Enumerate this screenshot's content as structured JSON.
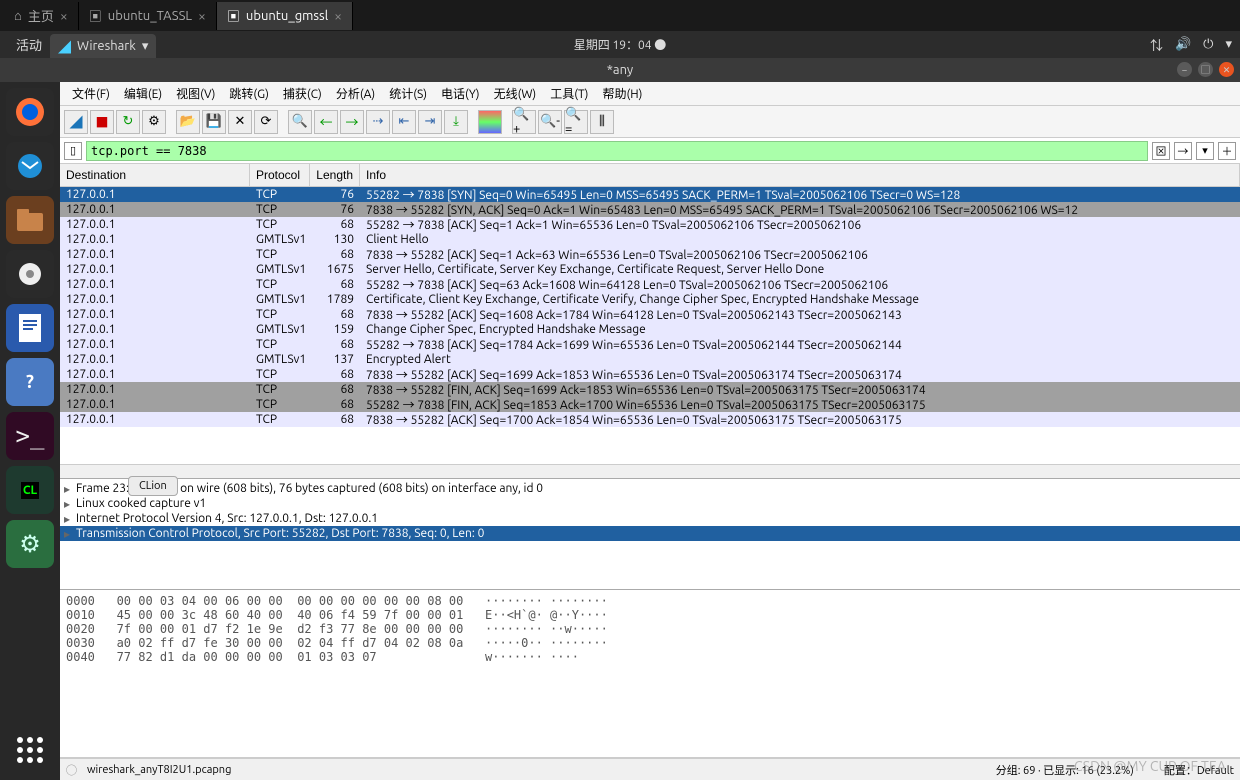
{
  "browser_tabs": [
    {
      "icon": "⌂",
      "label": "主页"
    },
    {
      "icon": "▣",
      "label": "ubuntu_TASSL"
    },
    {
      "icon": "▣",
      "label": "ubuntu_gmssl"
    }
  ],
  "system": {
    "activity": "活动",
    "app": "Wireshark",
    "clock": "星期四 19：04 ●"
  },
  "app_title": "*any",
  "menu": [
    "文件(F)",
    "编辑(E)",
    "视图(V)",
    "跳转(G)",
    "捕获(C)",
    "分析(A)",
    "统计(S)",
    "电话(Y)",
    "无线(W)",
    "工具(T)",
    "帮助(H)"
  ],
  "filter": {
    "value": "tcp.port == 7838"
  },
  "columns": {
    "dest": "Destination",
    "proto": "Protocol",
    "len": "Length",
    "info": "Info"
  },
  "packets": [
    {
      "cls": "c-syn-sel",
      "dest": "127.0.0.1",
      "proto": "TCP",
      "len": "76",
      "info": "55282 → 7838 [SYN] Seq=0 Win=65495 Len=0 MSS=65495 SACK_PERM=1 TSval=2005062106 TSecr=0 WS=128"
    },
    {
      "cls": "c-synack",
      "dest": "127.0.0.1",
      "proto": "TCP",
      "len": "76",
      "info": "7838 → 55282 [SYN, ACK] Seq=0 Ack=1 Win=65483 Len=0 MSS=65495 SACK_PERM=1 TSval=2005062106 TSecr=2005062106 WS=12"
    },
    {
      "cls": "c-tcp",
      "dest": "127.0.0.1",
      "proto": "TCP",
      "len": "68",
      "info": "55282 → 7838 [ACK] Seq=1 Ack=1 Win=65536 Len=0 TSval=2005062106 TSecr=2005062106"
    },
    {
      "cls": "c-gmtls",
      "dest": "127.0.0.1",
      "proto": "GMTLSv1",
      "len": "130",
      "info": "Client Hello"
    },
    {
      "cls": "c-tcp",
      "dest": "127.0.0.1",
      "proto": "TCP",
      "len": "68",
      "info": "7838 → 55282 [ACK] Seq=1 Ack=63 Win=65536 Len=0 TSval=2005062106 TSecr=2005062106"
    },
    {
      "cls": "c-gmtls",
      "dest": "127.0.0.1",
      "proto": "GMTLSv1",
      "len": "1675",
      "info": "Server Hello, Certificate, Server Key Exchange, Certificate Request, Server Hello Done"
    },
    {
      "cls": "c-tcp",
      "dest": "127.0.0.1",
      "proto": "TCP",
      "len": "68",
      "info": "55282 → 7838 [ACK] Seq=63 Ack=1608 Win=64128 Len=0 TSval=2005062106 TSecr=2005062106"
    },
    {
      "cls": "c-gmtls",
      "dest": "127.0.0.1",
      "proto": "GMTLSv1",
      "len": "1789",
      "info": "Certificate, Client Key Exchange, Certificate Verify, Change Cipher Spec, Encrypted Handshake Message"
    },
    {
      "cls": "c-tcp",
      "dest": "127.0.0.1",
      "proto": "TCP",
      "len": "68",
      "info": "7838 → 55282 [ACK] Seq=1608 Ack=1784 Win=64128 Len=0 TSval=2005062143 TSecr=2005062143"
    },
    {
      "cls": "c-gmtls",
      "dest": "127.0.0.1",
      "proto": "GMTLSv1",
      "len": "159",
      "info": "Change Cipher Spec, Encrypted Handshake Message"
    },
    {
      "cls": "c-tcp",
      "dest": "127.0.0.1",
      "proto": "TCP",
      "len": "68",
      "info": "55282 → 7838 [ACK] Seq=1784 Ack=1699 Win=65536 Len=0 TSval=2005062144 TSecr=2005062144"
    },
    {
      "cls": "c-gmtls",
      "dest": "127.0.0.1",
      "proto": "GMTLSv1",
      "len": "137",
      "info": "Encrypted Alert"
    },
    {
      "cls": "c-tcp",
      "dest": "127.0.0.1",
      "proto": "TCP",
      "len": "68",
      "info": "7838 → 55282 [ACK] Seq=1699 Ack=1853 Win=65536 Len=0 TSval=2005063174 TSecr=2005063174"
    },
    {
      "cls": "c-fin",
      "dest": "127.0.0.1",
      "proto": "TCP",
      "len": "68",
      "info": "7838 → 55282 [FIN, ACK] Seq=1699 Ack=1853 Win=65536 Len=0 TSval=2005063175 TSecr=2005063174"
    },
    {
      "cls": "c-fin",
      "dest": "127.0.0.1",
      "proto": "TCP",
      "len": "68",
      "info": "55282 → 7838 [FIN, ACK] Seq=1853 Ack=1700 Win=65536 Len=0 TSval=2005063175 TSecr=2005063175"
    },
    {
      "cls": "c-tcp",
      "dest": "127.0.0.1",
      "proto": "TCP",
      "len": "68",
      "info": "7838 → 55282 [ACK] Seq=1700 Ack=1854 Win=65536 Len=0 TSval=2005063175 TSecr=2005063175"
    }
  ],
  "popup": "CLion",
  "details": [
    {
      "sel": false,
      "txt": "Frame 23: 76 bytes on wire (608 bits), 76 bytes captured (608 bits) on interface any, id 0"
    },
    {
      "sel": false,
      "txt": "Linux cooked capture v1"
    },
    {
      "sel": false,
      "txt": "Internet Protocol Version 4, Src: 127.0.0.1, Dst: 127.0.0.1"
    },
    {
      "sel": true,
      "txt": "Transmission Control Protocol, Src Port: 55282, Dst Port: 7838, Seq: 0, Len: 0"
    }
  ],
  "hex": [
    "0000   00 00 03 04 00 06 00 00  00 00 00 00 00 00 08 00   ········ ········",
    "0010   45 00 00 3c 48 60 40 00  40 06 f4 59 7f 00 00 01   E··<H`@· @··Y····",
    "0020   7f 00 00 01 d7 f2 1e 9e  d2 f3 77 8e 00 00 00 00   ········ ··w·····",
    "0030   a0 02 ff d7 fe 30 00 00  02 04 ff d7 04 02 08 0a   ·····0·· ········",
    "0040   77 82 d1 da 00 00 00 00  01 03 03 07               w······· ····"
  ],
  "status": {
    "file": "wireshark_anyT8I2U1.pcapng",
    "counts": "分组: 69 · 已显示: 16 (23.2%)",
    "profile": "配置：Default"
  },
  "watermark": "CSDN @MY CUP OF TEA"
}
